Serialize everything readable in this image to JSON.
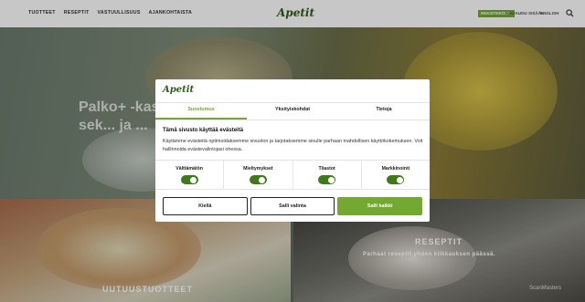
{
  "nav": {
    "logo": "Apetit",
    "items": [
      {
        "label": "TUOTTEET"
      },
      {
        "label": "RESEPTIT"
      },
      {
        "label": "VASTUULLISUUS"
      },
      {
        "label": "AJANKOHTAISTA"
      }
    ],
    "register_label": "REKISTERÖIDY",
    "links": [
      {
        "label": "KIRJAUDU SISÄÄN"
      },
      {
        "label": "|"
      },
      {
        "label": "ENGLISH"
      }
    ]
  },
  "hero": {
    "text": "Palko+ -kasviksekoitukset värikäs sek... ja ..."
  },
  "tiles": {
    "left_title": "UUTUUSTUOTTEET",
    "right_title": "RESEPTIT",
    "right_sub": "Parhaat reseptit yhden klikkauksen päässä."
  },
  "dialog": {
    "logo": "Apetit",
    "tabs": [
      {
        "label": "Suostumus",
        "active": true
      },
      {
        "label": "Yksityiskohdat",
        "active": false
      },
      {
        "label": "Tietoja",
        "active": false
      }
    ],
    "heading": "Tämä sivusto käyttää evästeitä",
    "body": "Käytämme evästeitä optimoidaksemme sivuston ja tarjotaksemme sinulle parhaan mahdollisen käyttökokemuksen. Voit hallinnoida evästevalintojasi ohessa.",
    "toggles": [
      {
        "label": "Välttämätön",
        "checked": true
      },
      {
        "label": "Mieltymykset",
        "checked": true
      },
      {
        "label": "Tilastot",
        "checked": true
      },
      {
        "label": "Markkinointi",
        "checked": true
      }
    ],
    "buttons": {
      "deny": "Kiellä",
      "allow_selection": "Salli valinta",
      "allow_all": "Salli kaikki"
    }
  },
  "badge": "ScanMasters",
  "colors": {
    "accent": "#73a831",
    "toggle_on": "#3f7a1a",
    "brand": "#2f5a1e"
  }
}
